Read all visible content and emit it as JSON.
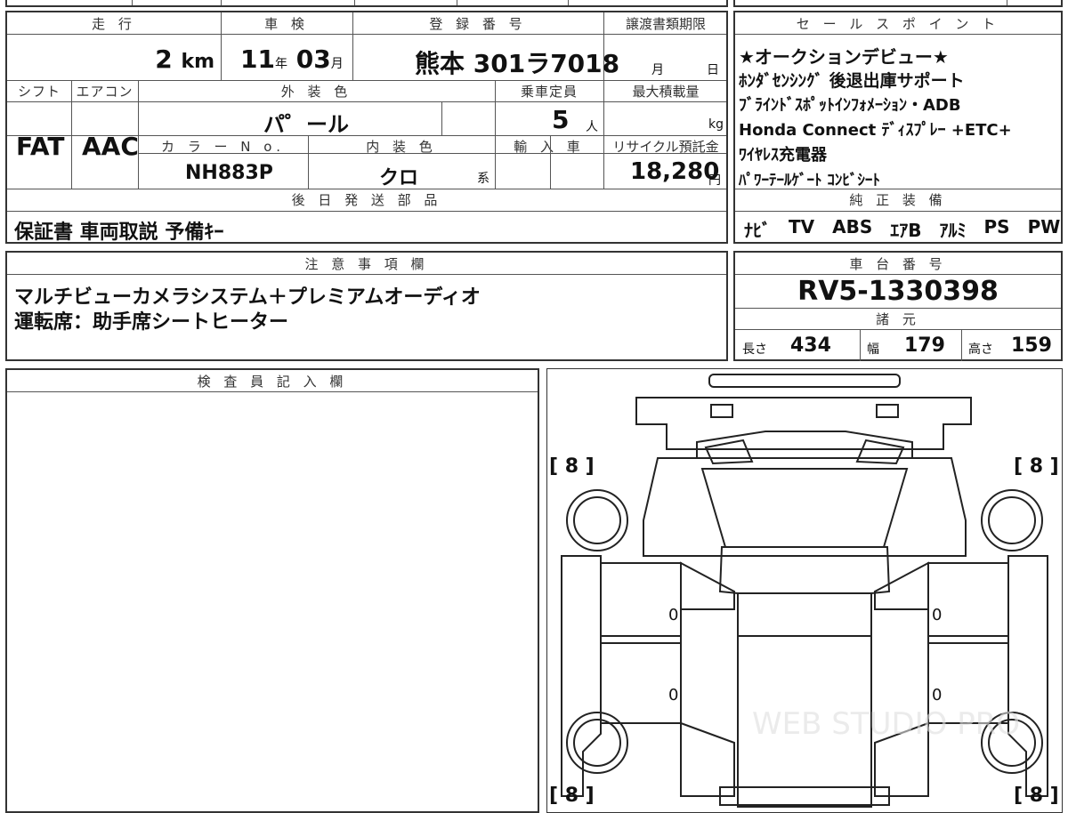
{
  "top": {
    "mileage_label": "走 行",
    "mileage_value": "2",
    "mileage_unit": "km",
    "inspection_label": "車 検",
    "inspection_year": "11",
    "year_unit": "年",
    "inspection_month": "03",
    "month_unit": "月",
    "registration_label": "登 録 番 号",
    "registration_value": "熊本 301ラ7018",
    "transfer_label": "譲渡書類期限",
    "transfer_month_unit": "月",
    "transfer_day_unit": "日",
    "shift_label": "シフト",
    "shift_value": "FAT",
    "ac_label": "エアコン",
    "ac_value": "AAC",
    "exterior_label": "外 装 色",
    "exterior_value": "パ゜ール",
    "capacity_label": "乗車定員",
    "capacity_value": "5",
    "capacity_unit": "人",
    "maxload_label": "最大積載量",
    "maxload_unit": "kg",
    "colorno_label": "カ ラ ー N o.",
    "colorno_value": "NH883P",
    "interior_label": "内 装 色",
    "interior_value": "クロ",
    "interior_suffix": "系",
    "import_label": "輸 入 車",
    "recycle_label": "リサイクル預託金",
    "recycle_value": "18,280",
    "recycle_unit": "円",
    "later_label": "後 日 発 送 部 品",
    "later_value": "保証書 車両取説 予備ｷｰ"
  },
  "sales": {
    "label": "セ ー ル ス ポ イ ン ト",
    "lines": [
      "★オークションデビュー★",
      "ﾎﾝﾀﾞｾﾝｼﾝｸﾞ 後退出庫サポート",
      "ﾌﾞﾗｲﾝﾄﾞｽﾎﾟｯﾄｲﾝﾌｫﾒｰｼｮﾝ・ADB",
      "Honda Connect ﾃﾞｨｽﾌﾟﾚｰ +ETC+",
      "ﾜｲﾔﾚｽ充電器",
      "ﾊﾟﾜｰﾃｰﾙｹﾞｰﾄ ｺﾝﾋﾞｼｰﾄ"
    ]
  },
  "equipment": {
    "label": "純 正 装 備",
    "items": [
      "ﾅﾋﾞ",
      "TV",
      "ABS",
      "ｴｱB",
      "ｱﾙﾐ",
      "PS",
      "PW"
    ]
  },
  "notes": {
    "label": "注 意 事 項 欄",
    "lines": [
      "マルチビューカメラシステム＋プレミアムオーディオ",
      "運転席：助手席シートヒーター"
    ]
  },
  "chassis": {
    "label": "車 台 番 号",
    "value": "RV5-1330398"
  },
  "specs": {
    "label": "諸 元",
    "length_label": "長さ",
    "length_value": "434",
    "width_label": "幅",
    "width_value": "179",
    "height_label": "高さ",
    "height_value": "159"
  },
  "inspector": {
    "label": "検 査 員 記 入 欄"
  },
  "diagram": {
    "tire_fl": "[ 8 ]",
    "tire_fr": "[ 8 ]",
    "tire_rl": "[ 8 ]",
    "tire_rr": "[ 8 ]",
    "door_fl": "0",
    "door_rl": "0",
    "door_fr": "0",
    "door_rr": "0",
    "watermark": "WEB STUDIO PRO"
  }
}
